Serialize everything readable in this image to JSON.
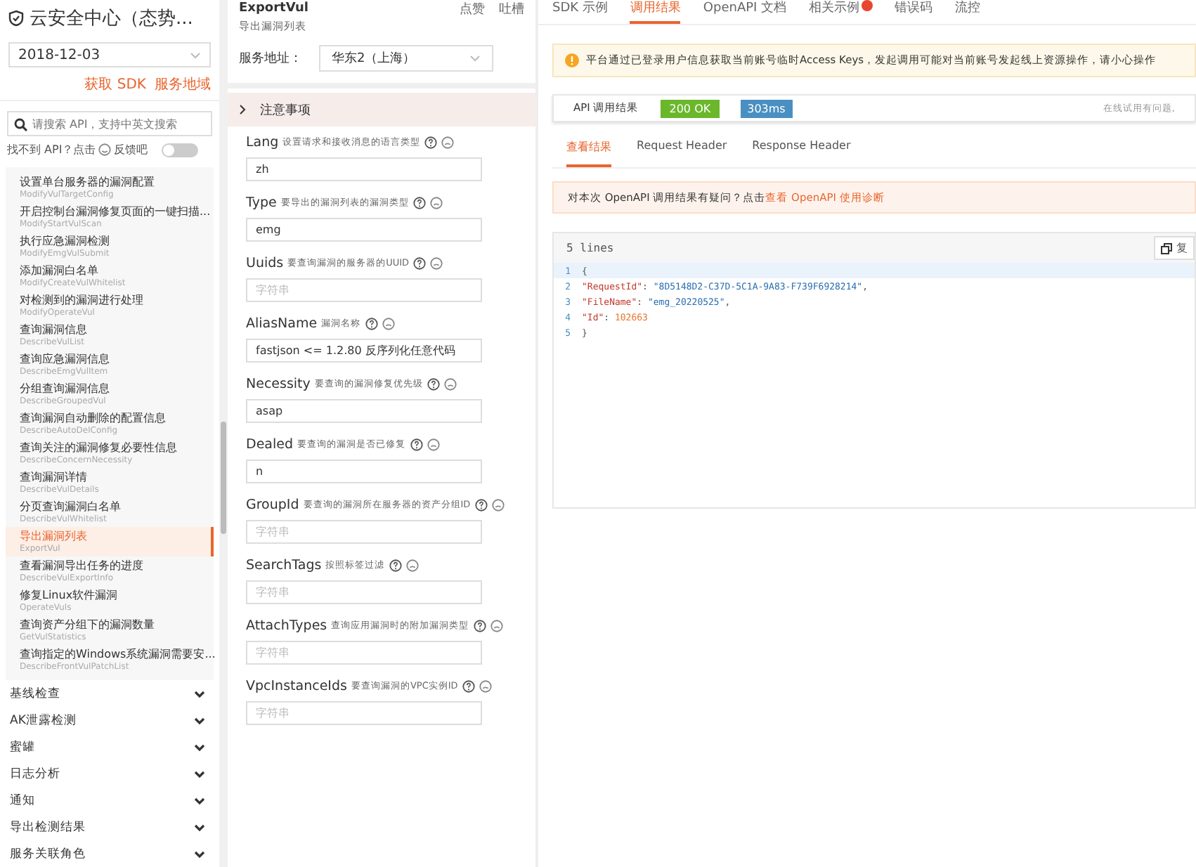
{
  "product": {
    "title": "云安全中心（态势...",
    "date": "2018-12-03",
    "links": [
      "获取 SDK",
      "服务地域"
    ]
  },
  "search": {
    "placeholder": "请搜索 API，支持中英文搜索",
    "hint": "找不到 API？点击",
    "feedback": "反馈吧",
    "toggle_on": false
  },
  "api_items": [
    {
      "title": "设置单台服务器的漏洞配置",
      "name": "ModifyVulTargetConfig",
      "selected": false
    },
    {
      "title": "开启控制台漏洞修复页面的一键扫描...",
      "name": "ModifyStartVulScan",
      "selected": false
    },
    {
      "title": "执行应急漏洞检测",
      "name": "ModifyEmgVulSubmit",
      "selected": false
    },
    {
      "title": "添加漏洞白名单",
      "name": "ModifyCreateVulWhitelist",
      "selected": false
    },
    {
      "title": "对检测到的漏洞进行处理",
      "name": "ModifyOperateVul",
      "selected": false
    },
    {
      "title": "查询漏洞信息",
      "name": "DescribeVulList",
      "selected": false
    },
    {
      "title": "查询应急漏洞信息",
      "name": "DescribeEmgVulItem",
      "selected": false
    },
    {
      "title": "分组查询漏洞信息",
      "name": "DescribeGroupedVul",
      "selected": false
    },
    {
      "title": "查询漏洞自动删除的配置信息",
      "name": "DescribeAutoDelConfig",
      "selected": false
    },
    {
      "title": "查询关注的漏洞修复必要性信息",
      "name": "DescribeConcernNecessity",
      "selected": false
    },
    {
      "title": "查询漏洞详情",
      "name": "DescribeVulDetails",
      "selected": false
    },
    {
      "title": "分页查询漏洞白名单",
      "name": "DescribeVulWhitelist",
      "selected": false
    },
    {
      "title": "导出漏洞列表",
      "name": "ExportVul",
      "selected": true
    },
    {
      "title": "查看漏洞导出任务的进度",
      "name": "DescribeVulExportInfo",
      "selected": false
    },
    {
      "title": "修复Linux软件漏洞",
      "name": "OperateVuls",
      "selected": false
    },
    {
      "title": "查询资产分组下的漏洞数量",
      "name": "GetVulStatistics",
      "selected": false
    },
    {
      "title": "查询指定的Windows系统漏洞需要安...",
      "name": "DescribeFrontVulPatchList",
      "selected": false
    }
  ],
  "groups": [
    {
      "label": "基线检查",
      "expanded": false
    },
    {
      "label": "AK泄露检测",
      "expanded": false
    },
    {
      "label": "蜜罐",
      "expanded": false
    },
    {
      "label": "日志分析",
      "expanded": false
    },
    {
      "label": "通知",
      "expanded": false
    },
    {
      "label": "导出检测结果",
      "expanded": false
    },
    {
      "label": "服务关联角色",
      "expanded": false
    }
  ],
  "api": {
    "name": "ExportVul",
    "like": "点赞",
    "complain": "吐槽",
    "description": "导出漏洞列表",
    "endpoint_label": "服务地址：",
    "endpoint": "华东2（上海）",
    "notice": "注意事项"
  },
  "params": [
    {
      "name": "Lang",
      "desc": "设置请求和接收消息的语言类型",
      "value": "zh"
    },
    {
      "name": "Type",
      "desc": "要导出的漏洞列表的漏洞类型",
      "value": "emg"
    },
    {
      "name": "Uuids",
      "desc": "要查询漏洞的服务器的UUID",
      "placeholder": "字符串"
    },
    {
      "name": "AliasName",
      "desc": "漏洞名称",
      "value": "fastjson <= 1.2.80 反序列化任意代码"
    },
    {
      "name": "Necessity",
      "desc": "要查询的漏洞修复优先级",
      "value": "asap"
    },
    {
      "name": "Dealed",
      "desc": "要查询的漏洞是否已修复",
      "value": "n"
    },
    {
      "name": "GroupId",
      "desc": "要查询的漏洞所在服务器的资产分组ID",
      "placeholder": "字符串"
    },
    {
      "name": "SearchTags",
      "desc": "按照标签过滤",
      "placeholder": "字符串"
    },
    {
      "name": "AttachTypes",
      "desc": "查询应用漏洞时的附加漏洞类型",
      "placeholder": "字符串"
    },
    {
      "name": "VpcInstanceIds",
      "desc": "要查询漏洞的VPC实例ID",
      "placeholder": "字符串"
    }
  ],
  "tabs": [
    {
      "label": "SDK 示例",
      "selected": false,
      "badge": false
    },
    {
      "label": "调用结果",
      "selected": true,
      "badge": false
    },
    {
      "label": "OpenAPI 文档",
      "selected": false,
      "badge": false
    },
    {
      "label": "相关示例",
      "selected": false,
      "badge": true
    },
    {
      "label": "错误码",
      "selected": false,
      "badge": false
    },
    {
      "label": "流控",
      "selected": false,
      "badge": false
    }
  ],
  "warning": "平台通过已登录用户信息获取当前账号临时Access Keys，发起调用可能对当前账号发起线上资源操作，请小心操作",
  "result": {
    "label": "API 调用结果",
    "status": "200 OK",
    "time": "303ms",
    "help": "在线试用有问题,"
  },
  "result_tabs": [
    {
      "label": "查看结果",
      "selected": true
    },
    {
      "label": "Request Header",
      "selected": false
    },
    {
      "label": "Response Header",
      "selected": false
    }
  ],
  "diagnose": {
    "text": "对本次 OpenAPI 调用结果有疑问？点击",
    "link": "查看 OpenAPI 使用诊断"
  },
  "code": {
    "line_count": "5 lines",
    "copy": "复",
    "lines": [
      {
        "number": "1",
        "tokens": [
          {
            "kind": "punct",
            "text": "{"
          }
        ]
      },
      {
        "number": "2",
        "tokens": [
          {
            "kind": "key",
            "text": "\"RequestId\""
          },
          {
            "kind": "punct",
            "text": ": "
          },
          {
            "kind": "str",
            "text": "\"8D5148D2-C37D-5C1A-9A83-F739F6928214\""
          },
          {
            "kind": "punct",
            "text": ","
          }
        ]
      },
      {
        "number": "3",
        "tokens": [
          {
            "kind": "key",
            "text": "\"FileName\""
          },
          {
            "kind": "punct",
            "text": ": "
          },
          {
            "kind": "str",
            "text": "\"emg_20220525\""
          },
          {
            "kind": "punct",
            "text": ","
          }
        ]
      },
      {
        "number": "4",
        "tokens": [
          {
            "kind": "key",
            "text": "\"Id\""
          },
          {
            "kind": "punct",
            "text": ": "
          },
          {
            "kind": "num",
            "text": "102663"
          }
        ]
      },
      {
        "number": "5",
        "tokens": [
          {
            "kind": "punct",
            "text": "}"
          }
        ]
      }
    ]
  }
}
